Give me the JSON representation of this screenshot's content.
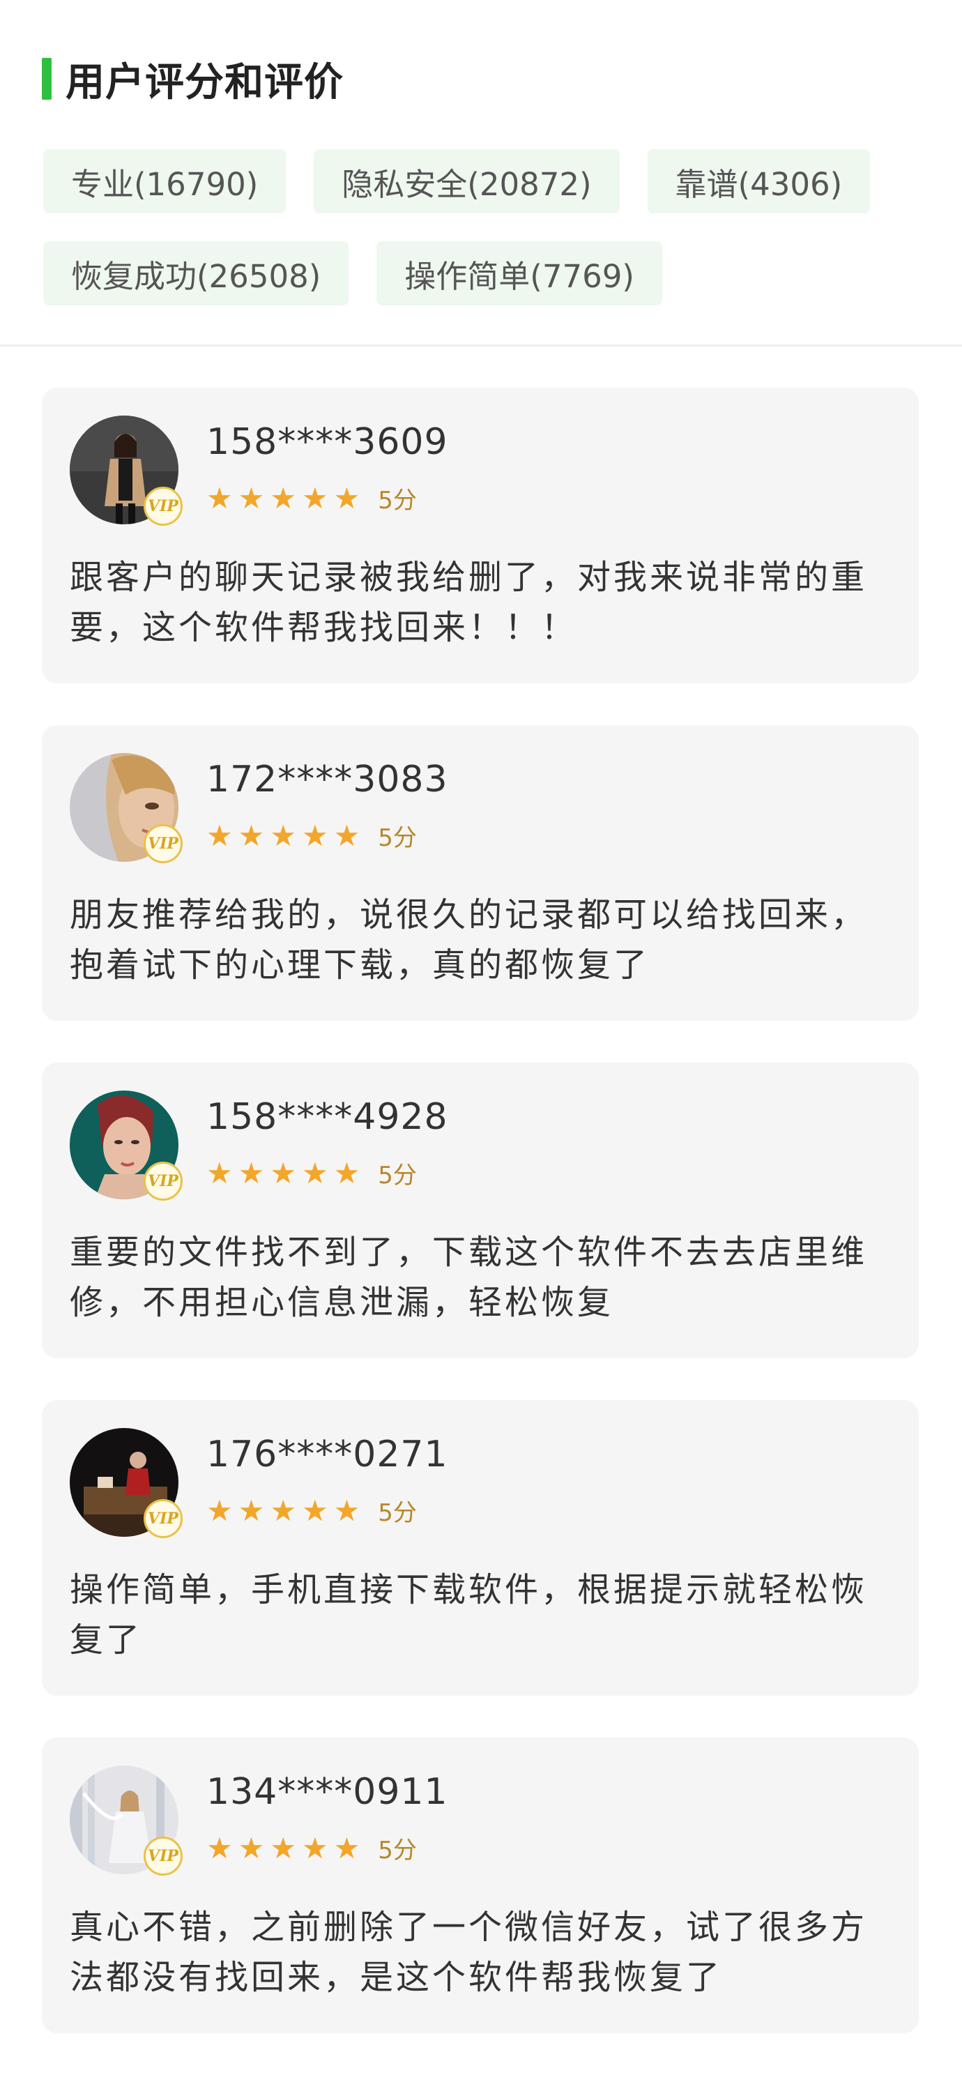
{
  "header": {
    "title": "用户评分和评价",
    "accent_color": "#2fbf3f"
  },
  "tags": [
    {
      "label": "专业(16790)"
    },
    {
      "label": "隐私安全(20872)"
    },
    {
      "label": "靠谱(4306)"
    },
    {
      "label": "恢复成功(26508)"
    },
    {
      "label": "操作简单(7769)"
    }
  ],
  "reviews": [
    {
      "user": "158****3609",
      "stars": 5,
      "score_label": "5分",
      "badge": "VIP",
      "text": "跟客户的聊天记录被我给删了，对我来说非常的重要，这个软件帮我找回来！！！"
    },
    {
      "user": "172****3083",
      "stars": 5,
      "score_label": "5分",
      "badge": "VIP",
      "text": "朋友推荐给我的，说很久的记录都可以给找回来，抱着试下的心理下载，真的都恢复了"
    },
    {
      "user": "158****4928",
      "stars": 5,
      "score_label": "5分",
      "badge": "VIP",
      "text": "重要的文件找不到了，下载这个软件不去去店里维修，不用担心信息泄漏，轻松恢复"
    },
    {
      "user": "176****0271",
      "stars": 5,
      "score_label": "5分",
      "badge": "VIP",
      "text": "操作简单，手机直接下载软件，根据提示就轻松恢复了"
    },
    {
      "user": "134****0911",
      "stars": 5,
      "score_label": "5分",
      "badge": "VIP",
      "text": "真心不错，之前删除了一个微信好友，试了很多方法都没有找回来，是这个软件帮我恢复了"
    }
  ],
  "colors": {
    "star": "#f2a62a",
    "tag_bg": "#eef8ee",
    "card_bg": "#f5f5f5"
  }
}
